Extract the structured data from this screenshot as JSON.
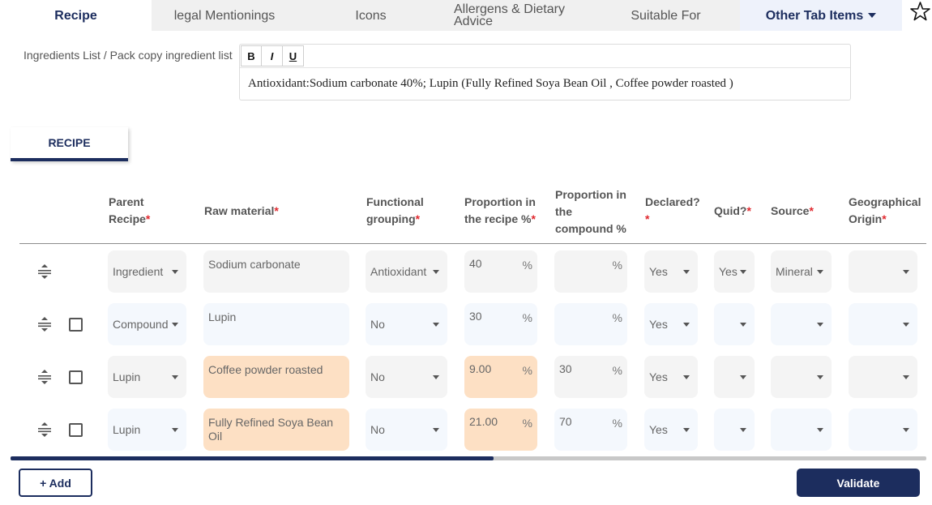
{
  "tabs": [
    {
      "label": "Recipe",
      "state": "active"
    },
    {
      "label": "legal Mentionings"
    },
    {
      "label": "Icons"
    },
    {
      "label": "Allergens & Dietary Advice"
    },
    {
      "label": "Suitable For"
    },
    {
      "label": "Other Tab Items",
      "state": "dropdown"
    }
  ],
  "star_icon": "star-outline-icon",
  "ingredients": {
    "label": "Ingredients List / Pack copy ingredient list",
    "toolbar": {
      "bold": "B",
      "italic": "I",
      "underline": "U"
    },
    "text": "Antioxidant:Sodium carbonate 40%; Lupin (Fully Refined Soya Bean Oil , Coffee powder roasted )"
  },
  "section_tab": "RECIPE",
  "columns": {
    "parent": {
      "line1": "Parent",
      "line2": "Recipe"
    },
    "raw": "Raw material",
    "functional": {
      "line1": "Functional",
      "line2": "grouping"
    },
    "proportion_recipe": {
      "line1": "Proportion in",
      "line2": "the recipe %"
    },
    "proportion_compound": {
      "line1": "Proportion in",
      "line2": "the",
      "line3": "compound %"
    },
    "declared": "Declared?",
    "quid": "Quid?",
    "source": "Source",
    "geo": {
      "line1": "Geographical",
      "line2": "Origin"
    },
    "required_mark": "*"
  },
  "rows": [
    {
      "parent": "Ingredient",
      "raw": "Sodium carbonate",
      "functional": "Antioxidant",
      "prop_recipe": "40",
      "prop_compound": "",
      "declared": "Yes",
      "quid": "Yes",
      "source": "Mineral",
      "geo": ""
    },
    {
      "parent": "Compound",
      "raw": "Lupin",
      "functional": "No",
      "prop_recipe": "30",
      "prop_compound": "",
      "declared": "Yes",
      "quid": "",
      "source": "",
      "geo": ""
    },
    {
      "parent": "Lupin",
      "raw": "Coffee powder roasted",
      "functional": "No",
      "prop_recipe": "9.00",
      "prop_compound": "30",
      "declared": "Yes",
      "quid": "",
      "source": "",
      "geo": ""
    },
    {
      "parent": "Lupin",
      "raw": "Fully Refined Soya Bean Oil",
      "functional": "No",
      "prop_recipe": "21.00",
      "prop_compound": "70",
      "declared": "Yes",
      "quid": "",
      "source": "",
      "geo": ""
    }
  ],
  "percent_sign": "%",
  "scrollbar_position": 0.53,
  "buttons": {
    "add": "+ Add",
    "validate": "Validate"
  },
  "colors": {
    "primary": "#1c2d5e",
    "required": "#e0282e",
    "highlight": "#fde0c4"
  }
}
